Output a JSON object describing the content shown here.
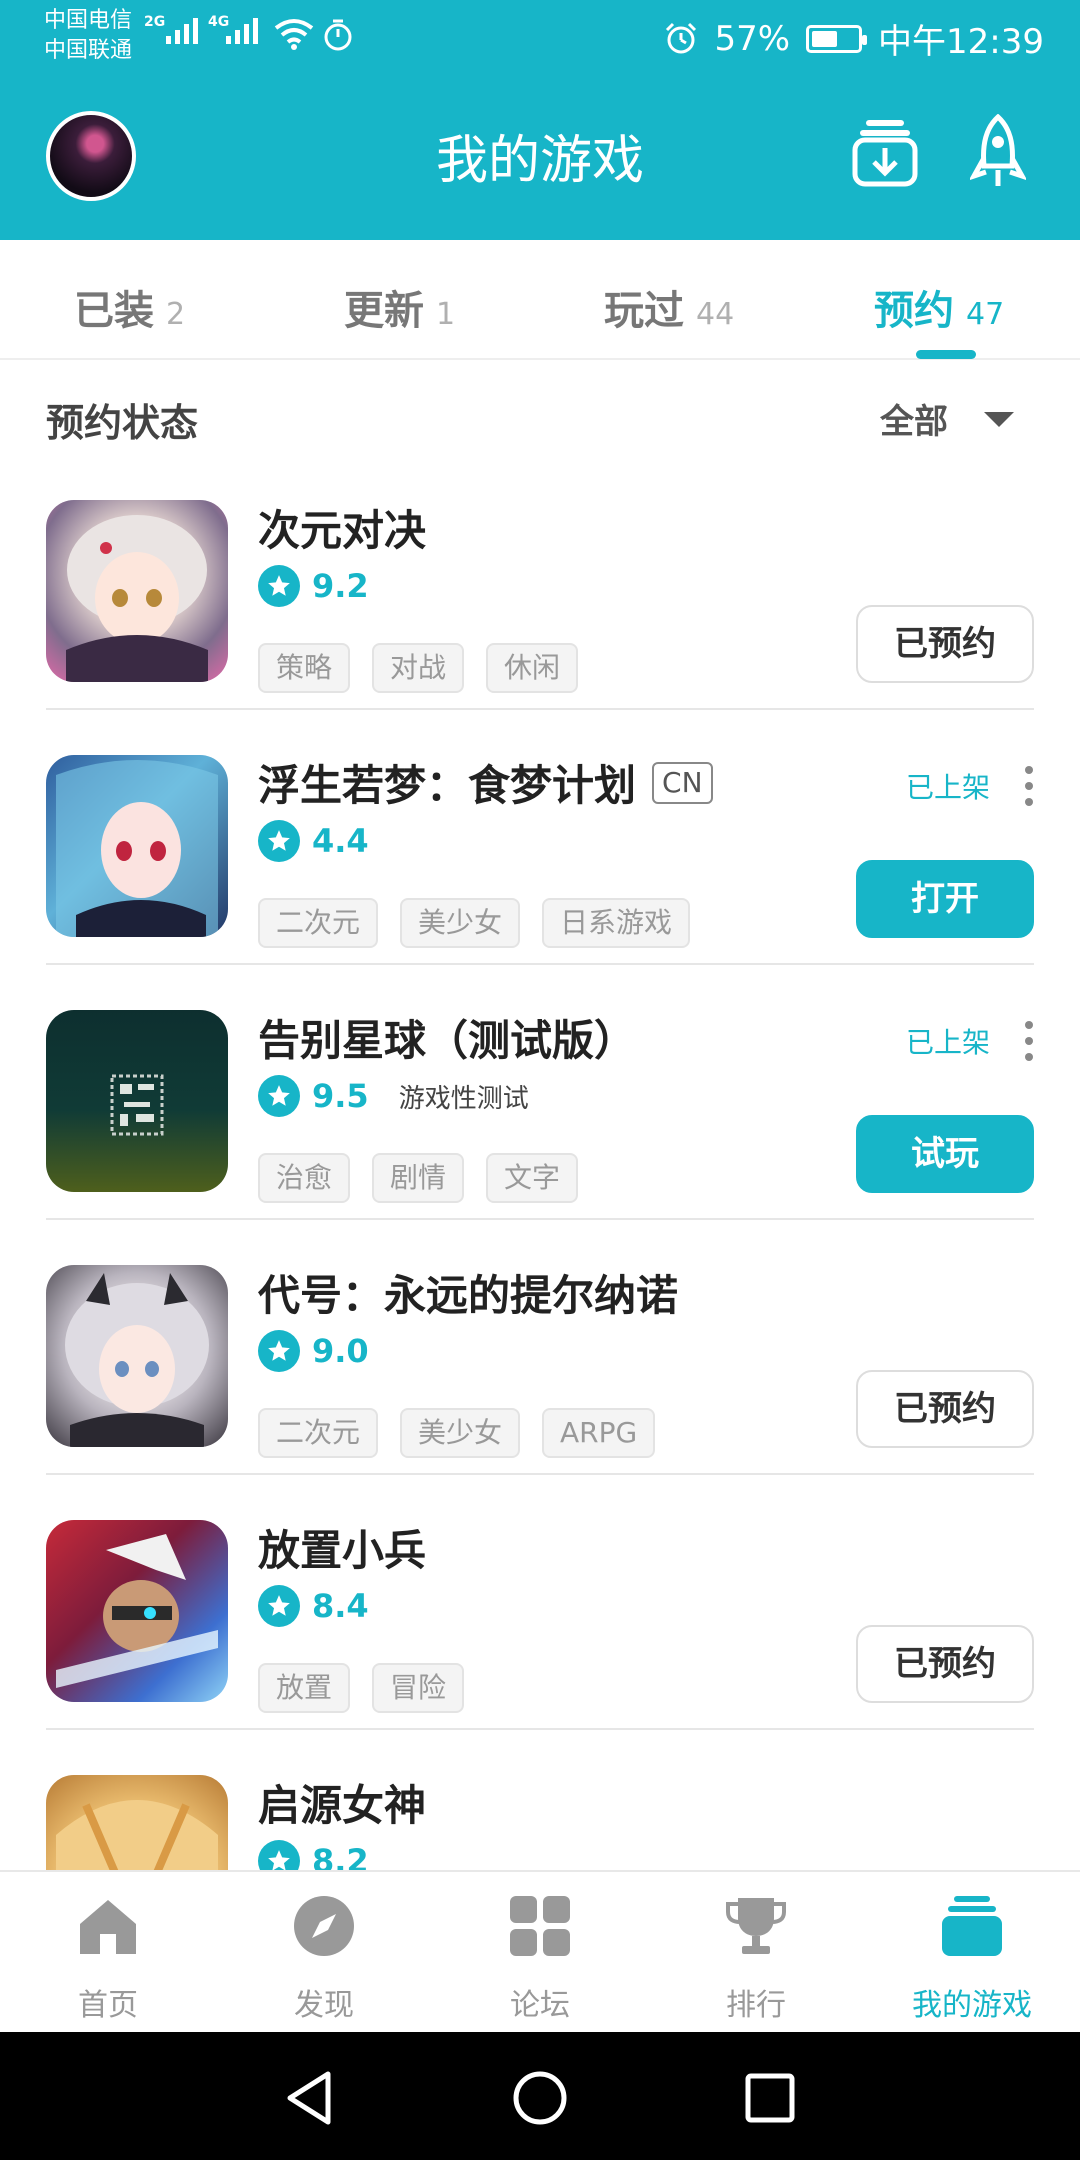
{
  "status_bar": {
    "carrier_1": "中国电信",
    "carrier_2": "中国联通",
    "signal_1": "2G",
    "signal_2": "4G",
    "battery": "57%",
    "battery_level": 0.57,
    "time": "中午12:39"
  },
  "header": {
    "title": "我的游戏",
    "avatar_icon": "user-avatar",
    "download_icon": "download-box-icon",
    "rocket_icon": "rocket-icon"
  },
  "tabs": [
    {
      "label": "已装",
      "count": "2",
      "active": false
    },
    {
      "label": "更新",
      "count": "1",
      "active": false
    },
    {
      "label": "玩过",
      "count": "44",
      "active": false
    },
    {
      "label": "预约",
      "count": "47",
      "active": true
    }
  ],
  "filter": {
    "label": "预约状态",
    "value": "全部"
  },
  "games": [
    {
      "name": "次元对决",
      "score": "9.2",
      "tags": [
        "策略",
        "对战",
        "休闲"
      ],
      "action": "已预约"
    },
    {
      "name": "浮生若梦：食梦计划",
      "badge": "CN",
      "score": "4.4",
      "tags": [
        "二次元",
        "美少女",
        "日系游戏"
      ],
      "status": "已上架",
      "action": "打开"
    },
    {
      "name": "告别星球（测试版）",
      "score": "9.5",
      "note": "游戏性测试",
      "tags": [
        "治愈",
        "剧情",
        "文字"
      ],
      "status": "已上架",
      "action": "试玩"
    },
    {
      "name": "代号：永远的提尔纳诺",
      "score": "9.0",
      "tags": [
        "二次元",
        "美少女",
        "ARPG"
      ],
      "action": "已预约"
    },
    {
      "name": "放置小兵",
      "score": "8.4",
      "tags": [
        "放置",
        "冒险"
      ],
      "action": "已预约"
    },
    {
      "name": "启源女神",
      "score": "8.2",
      "tags": []
    }
  ],
  "bottom_nav": [
    {
      "label": "首页",
      "icon": "home-icon"
    },
    {
      "label": "发现",
      "icon": "compass-icon"
    },
    {
      "label": "论坛",
      "icon": "grid-icon"
    },
    {
      "label": "排行",
      "icon": "trophy-icon"
    },
    {
      "label": "我的游戏",
      "icon": "my-games-icon",
      "active": true
    }
  ],
  "colors": {
    "accent": "#17b5c8",
    "text_dark": "#222222",
    "tag_text": "#999999"
  }
}
